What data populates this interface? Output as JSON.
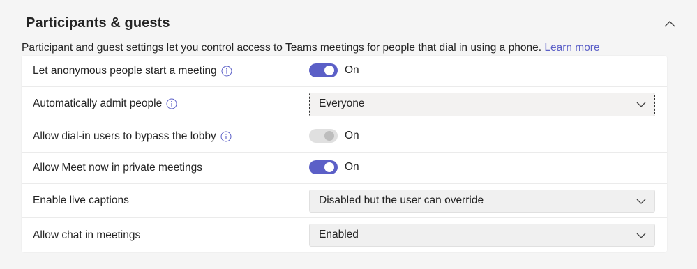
{
  "section": {
    "title": "Participants & guests",
    "collapse_icon": "chevron-up-icon"
  },
  "description": {
    "text": "Participant and guest settings let you control access to Teams meetings for people that dial in using a phone. ",
    "link": "Learn more"
  },
  "settings": [
    {
      "label": "Let anonymous people start a meeting",
      "info": true,
      "control": "toggle",
      "state": "On",
      "enabled": true
    },
    {
      "label": "Automatically admit people",
      "info": true,
      "control": "dropdown",
      "value": "Everyone"
    },
    {
      "label": "Allow dial-in users to bypass the lobby",
      "info": true,
      "control": "toggle",
      "state": "On",
      "enabled": false
    },
    {
      "label": "Allow Meet now in private meetings",
      "info": false,
      "control": "toggle",
      "state": "On",
      "enabled": true
    },
    {
      "label": "Enable live captions",
      "info": false,
      "control": "dropdown",
      "value": "Disabled but the user can override"
    },
    {
      "label": "Allow chat in meetings",
      "info": false,
      "control": "dropdown",
      "value": "Enabled"
    }
  ],
  "colors": {
    "accent": "#5b5fc7",
    "toggle_disabled": "#e0e0e0",
    "background": "#f5f5f5",
    "card": "#ffffff"
  }
}
